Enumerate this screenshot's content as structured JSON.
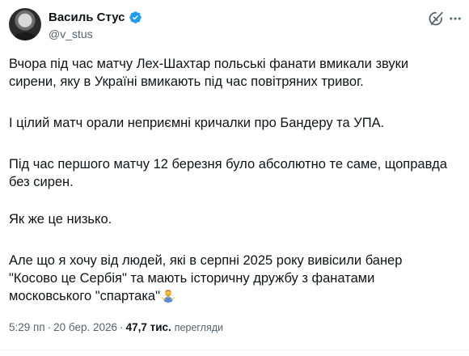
{
  "author": {
    "display_name": "Василь Стус",
    "handle": "@v_stus",
    "verified": true,
    "verified_color": "#1d9bf0"
  },
  "header_actions": {
    "grok_icon": "grok-icon",
    "more_icon": "more-dots-icon"
  },
  "tweet": {
    "paragraphs": [
      "Вчора під час матчу Лех-Шахтар польські фанати вмикали звуки\nсирени, яку в Україні вмикають під час повітряних тривог.",
      "І цілий матч орали неприємні кричалки про Бандеру та УПА.",
      "Під час першого матчу 12 березня було абсолютно те саме, щоправда\nбез сирен.",
      "Як же це низько.",
      "Але що я хочу від людей, які в серпні 2025 року вивісили банер\n\"Косово це Сербія\" та мають історичну дружбу з фанатами\nмосковського \"спартака\""
    ],
    "trailing_emoji": "person-shrugging-emoji"
  },
  "meta": {
    "time": "5:29 пп",
    "separator": "·",
    "date": "20 бер. 2026",
    "separator2": "·",
    "views_count": "47,7 тис.",
    "views_label": "перегляди"
  }
}
